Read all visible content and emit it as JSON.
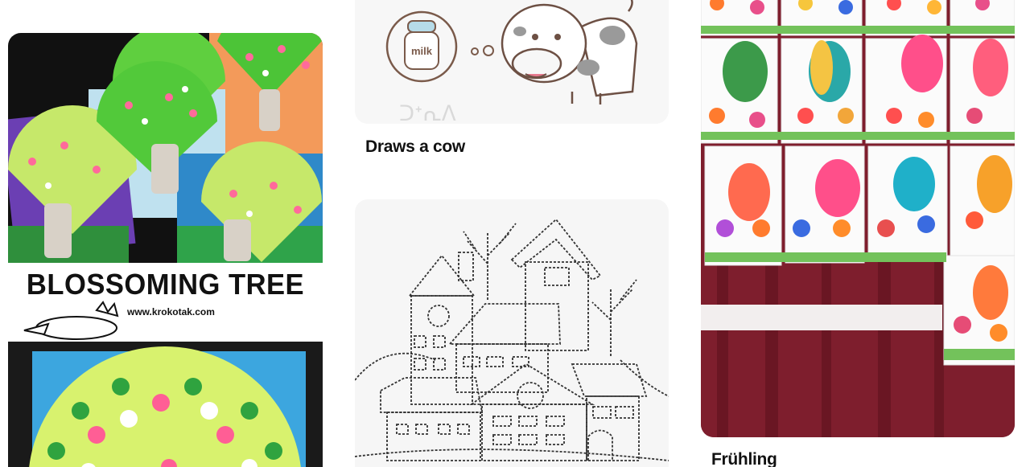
{
  "feed": {
    "pins": [
      {
        "id": "blossoming-tree",
        "image_text": {
          "headline": "BLOSSOMING TREE",
          "site": "www.krokotak.com"
        }
      },
      {
        "id": "draws-a-cow",
        "title": "Draws a cow",
        "image_text": {
          "jar_label": "milk"
        }
      },
      {
        "id": "houses-drawing"
      },
      {
        "id": "fruehling",
        "title": "Frühling"
      }
    ]
  },
  "colors": {
    "title_text": "#111111",
    "card_bg": "#f7f7f7",
    "page_bg": "#ffffff"
  }
}
